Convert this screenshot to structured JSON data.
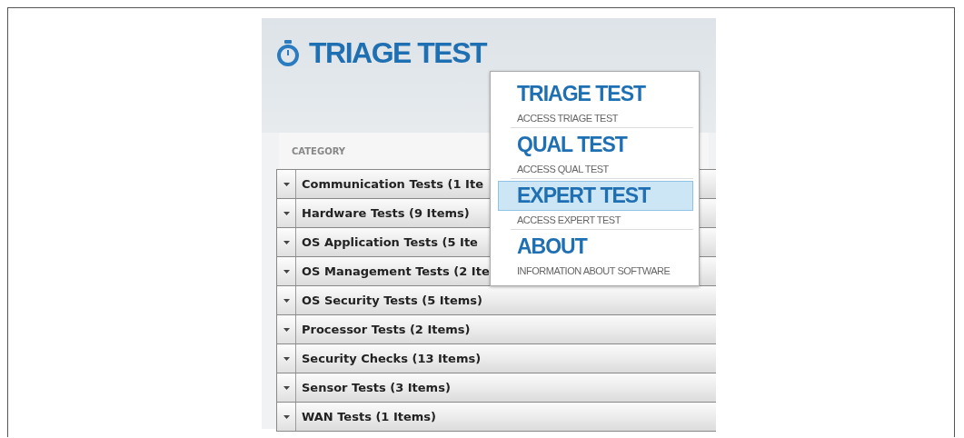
{
  "header": {
    "title": "TRIAGE TEST"
  },
  "table": {
    "column_header": "CATEGORY",
    "rows": [
      {
        "label": "Communication Tests (1 Ite"
      },
      {
        "label": "Hardware Tests (9 Items)"
      },
      {
        "label": "OS Application Tests (5 Ite"
      },
      {
        "label": "OS Management Tests (2 Ite"
      },
      {
        "label": "OS Security Tests (5 Items)"
      },
      {
        "label": "Processor Tests (2 Items)"
      },
      {
        "label": "Security Checks (13 Items)"
      },
      {
        "label": "Sensor Tests (3 Items)"
      },
      {
        "label": "WAN Tests (1 Items)"
      }
    ]
  },
  "menu": {
    "items": [
      {
        "title": "TRIAGE TEST",
        "subtitle": "ACCESS TRIAGE TEST",
        "selected": false
      },
      {
        "title": "QUAL TEST",
        "subtitle": "ACCESS QUAL TEST",
        "selected": false
      },
      {
        "title": "EXPERT TEST",
        "subtitle": "ACCESS EXPERT TEST",
        "selected": true
      },
      {
        "title": "ABOUT",
        "subtitle": "INFORMATION ABOUT SOFTWARE",
        "selected": false
      }
    ]
  }
}
